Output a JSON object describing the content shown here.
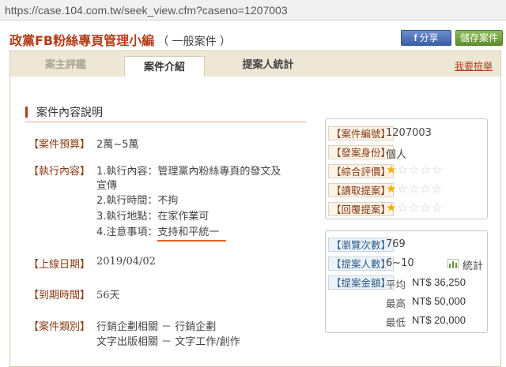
{
  "browser": {
    "url": "https://case.104.com.tw/seek_view.cfm?caseno=1207003"
  },
  "header": {
    "title": "政黨FB粉絲專頁管理小編",
    "case_type": "（ 一般案件 ）",
    "share_label": "分享",
    "share_icon": "f",
    "save_label": "儲存案件"
  },
  "tabs": {
    "review": "案主評鑑",
    "intro": "案件介紹",
    "stats": "提案人統計",
    "report": "我要檢舉"
  },
  "section": {
    "title": "案件內容說明"
  },
  "details": {
    "budget_label": "【案件預算】",
    "budget_value": "2萬~5萬",
    "exec_label": "【執行內容】",
    "exec_lines": [
      "1.執行內容：管理黨內粉絲專頁的發文及",
      "   宣傳",
      "2.執行時間：不拘",
      "3.執行地點：在家作業可",
      "4.注意事項：支持和平統一"
    ],
    "online_label": "【上線日期】",
    "online_value": "2019/04/02",
    "expire_label": "【到期時間】",
    "expire_value": "56天",
    "category_label": "【案件類別】",
    "category_lines": [
      "行銷企劃相關 － 行銷企劃",
      "文字出版相關 － 文字工作/創作"
    ]
  },
  "sidebar": {
    "case_no_label": "【案件編號】",
    "case_no": "1207003",
    "identity_label": "【發案身份】",
    "identity": "個人",
    "rating_label": "【綜合評價】",
    "rating": 1,
    "read_label": "【讀取提案】",
    "read_rating": 1,
    "reply_label": "【回覆提案】",
    "reply_rating": 1,
    "max_stars": 5,
    "views_label": "【瀏覽次數】",
    "views": "769",
    "proposers_label": "【提案人數】",
    "proposers": "6~10",
    "stats_label": "統計",
    "amount_label": "【提案金額】",
    "avg_label": "平均",
    "avg_value": "NT$ 36,250",
    "max_label": "最高",
    "max_value": "NT$ 50,000",
    "min_label": "最低",
    "min_value": "NT$ 20,000"
  },
  "colors": {
    "accent": "#b23c17",
    "star": "#f0b400",
    "highlight_underline": "#e8631e"
  }
}
